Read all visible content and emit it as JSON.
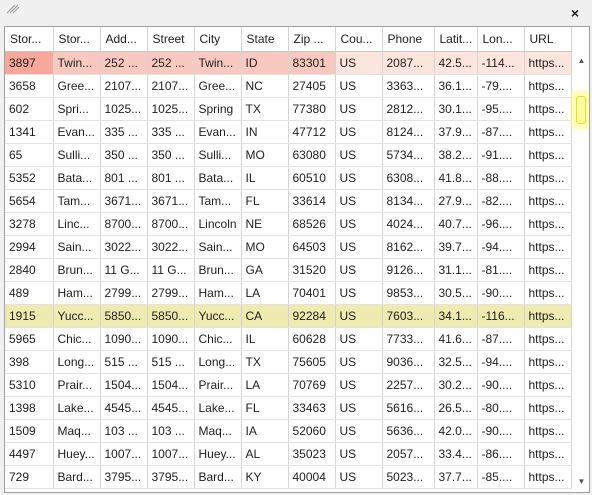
{
  "window": {
    "close_glyph": "×"
  },
  "table": {
    "columns": [
      "Stor...",
      "Stor...",
      "Add...",
      "Street",
      "City",
      "State",
      "Zip ...",
      "Cou...",
      "Phone",
      "Latit...",
      "Lon...",
      "URL"
    ],
    "rows": [
      [
        "3897",
        "Twin...",
        "252 ...",
        "252 ...",
        "Twin...",
        "ID",
        "83301",
        "US",
        "2087...",
        "42.5...",
        "-114...",
        "https..."
      ],
      [
        "3658",
        "Gree...",
        "2107...",
        "2107...",
        "Gree...",
        "NC",
        "27405",
        "US",
        "3363...",
        "36.1...",
        "-79....",
        "https..."
      ],
      [
        "602",
        "Spri...",
        "1025...",
        "1025...",
        "Spring",
        "TX",
        "77380",
        "US",
        "2812...",
        "30.1...",
        "-95....",
        "https..."
      ],
      [
        "1341",
        "Evan...",
        "335 ...",
        "335 ...",
        "Evan...",
        "IN",
        "47712",
        "US",
        "8124...",
        "37.9...",
        "-87....",
        "https..."
      ],
      [
        "65",
        "Sulli...",
        "350 ...",
        "350 ...",
        "Sulli...",
        "MO",
        "63080",
        "US",
        "5734...",
        "38.2...",
        "-91....",
        "https..."
      ],
      [
        "5352",
        "Bata...",
        "801 ...",
        "801 ...",
        "Bata...",
        "IL",
        "60510",
        "US",
        "6308...",
        "41.8...",
        "-88....",
        "https..."
      ],
      [
        "5654",
        "Tam...",
        "3671...",
        "3671...",
        "Tam...",
        "FL",
        "33614",
        "US",
        "8134...",
        "27.9...",
        "-82....",
        "https..."
      ],
      [
        "3278",
        "Linc...",
        "8700...",
        "8700...",
        "Lincoln",
        "NE",
        "68526",
        "US",
        "4024...",
        "40.7...",
        "-96....",
        "https..."
      ],
      [
        "2994",
        "Sain...",
        "3022...",
        "3022...",
        "Sain...",
        "MO",
        "64503",
        "US",
        "8162...",
        "39.7...",
        "-94....",
        "https..."
      ],
      [
        "2840",
        "Brun...",
        "11 G...",
        "11 G...",
        "Brun...",
        "GA",
        "31520",
        "US",
        "9126...",
        "31.1...",
        "-81....",
        "https..."
      ],
      [
        "489",
        "Ham...",
        "2799...",
        "2799...",
        "Ham...",
        "LA",
        "70401",
        "US",
        "9853...",
        "30.5...",
        "-90....",
        "https..."
      ],
      [
        "1915",
        "Yucc...",
        "5850...",
        "5850...",
        "Yucc...",
        "CA",
        "92284",
        "US",
        "7603...",
        "34.1...",
        "-116...",
        "https..."
      ],
      [
        "5965",
        "Chic...",
        "1090...",
        "1090...",
        "Chic...",
        "IL",
        "60628",
        "US",
        "7733...",
        "41.6...",
        "-87....",
        "https..."
      ],
      [
        "398",
        "Long...",
        "515 ...",
        "515 ...",
        "Long...",
        "TX",
        "75605",
        "US",
        "9036...",
        "32.5...",
        "-94....",
        "https..."
      ],
      [
        "5310",
        "Prair...",
        "1504...",
        "1504...",
        "Prair...",
        "LA",
        "70769",
        "US",
        "2257...",
        "30.2...",
        "-90....",
        "https..."
      ],
      [
        "1398",
        "Lake...",
        "4545...",
        "4545...",
        "Lake...",
        "FL",
        "33463",
        "US",
        "5616...",
        "26.5...",
        "-80....",
        "https..."
      ],
      [
        "1509",
        "Maq...",
        "103 ...",
        "103 ...",
        "Maq...",
        "IA",
        "52060",
        "US",
        "5636...",
        "42.0...",
        "-90....",
        "https..."
      ],
      [
        "4497",
        "Huey...",
        "1007...",
        "1007...",
        "Huey...",
        "AL",
        "35023",
        "US",
        "2057...",
        "33.4...",
        "-86....",
        "https..."
      ],
      [
        "729",
        "Bard...",
        "3795...",
        "3795...",
        "Bard...",
        "KY",
        "40004",
        "US",
        "5023...",
        "37.7...",
        "-85....",
        "https..."
      ]
    ],
    "selected_row": 0,
    "highlighted_row": 11
  },
  "scrollbar": {
    "up_glyph": "▲",
    "down_glyph": "▼",
    "position": 0.05
  },
  "colors": {
    "selected_row": "#f9c9c0",
    "highlighted_row": "#efeab0",
    "scroll_thumb": "#fffd9e"
  }
}
